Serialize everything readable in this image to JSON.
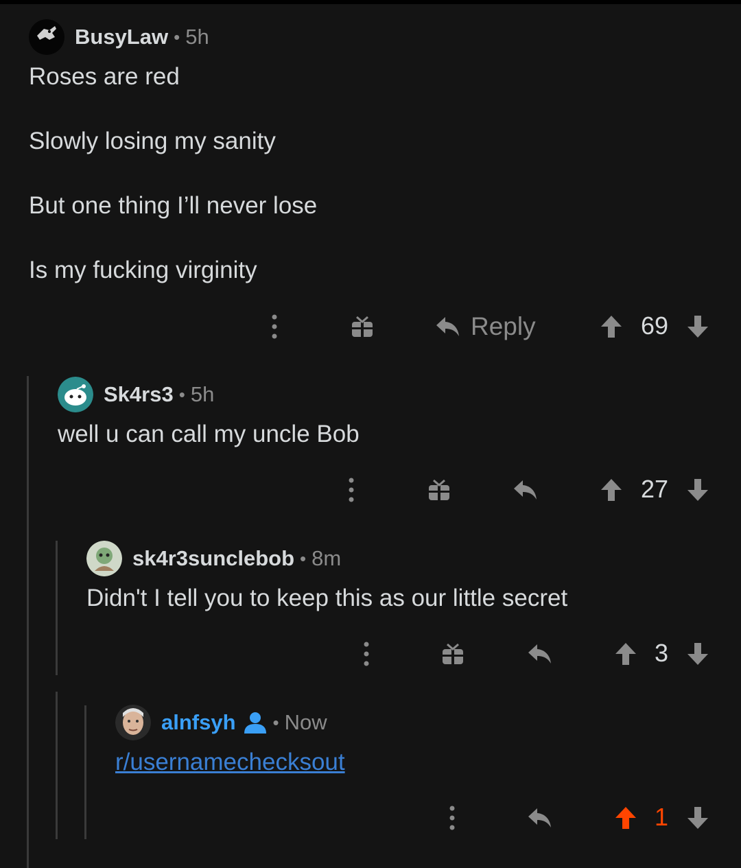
{
  "comments": [
    {
      "username": "BusyLaw",
      "separator": "•",
      "time": "5h",
      "lines": [
        "Roses are red",
        "Slowly losing my sanity",
        "But one thing I’ll never lose",
        "Is my fucking virginity"
      ],
      "reply_label": "Reply",
      "score": "69",
      "vote": "none"
    },
    {
      "username": "Sk4rs3",
      "separator": "•",
      "time": "5h",
      "text": "well u can call my uncle Bob",
      "score": "27",
      "vote": "none"
    },
    {
      "username": "sk4r3sunclebob",
      "separator": "•",
      "time": "8m",
      "text": "Didn't I tell you to keep this as our little secret",
      "score": "3",
      "vote": "none"
    },
    {
      "username": "alnfsyh",
      "separator": "•",
      "time": "Now",
      "text": "r/usernamechecksout",
      "score": "1",
      "vote": "up",
      "is_op": true
    }
  ],
  "colors": {
    "background": "#141414",
    "text": "#d7dadc",
    "muted": "#8b8b8b",
    "link": "#3a7fd4",
    "upvote_active": "#ff4500",
    "op_username": "#3a9ff6"
  },
  "icons": [
    "more-options-icon",
    "gift-icon",
    "reply-icon",
    "upvote-icon",
    "downvote-icon",
    "op-user-icon"
  ]
}
